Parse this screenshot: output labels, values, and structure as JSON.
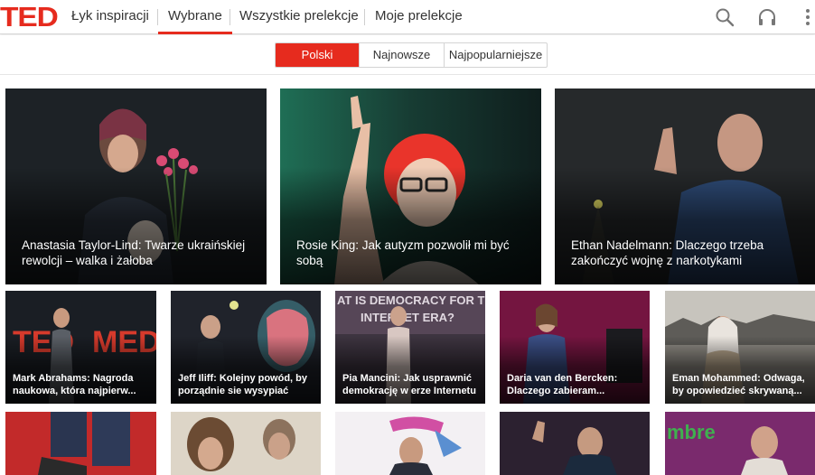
{
  "app": {
    "logo": "TED"
  },
  "nav": {
    "tabs": [
      {
        "label": "Łyk inspiracji"
      },
      {
        "label": "Wybrane"
      },
      {
        "label": "Wszystkie prelekcje"
      },
      {
        "label": "Moje prelekcje"
      }
    ],
    "active_tab": "Wybrane",
    "icons": [
      "search-icon",
      "headphones-icon",
      "overflow-menu-icon"
    ]
  },
  "filters": {
    "options": [
      {
        "label": "Polski"
      },
      {
        "label": "Najnowsze"
      },
      {
        "label": "Najpopularniejsze"
      }
    ],
    "selected": "Polski"
  },
  "featured": [
    {
      "title": "Anastasia Taylor-Lind: Twarze ukraińskiej rewolcji – walka i żałoba"
    },
    {
      "title": "Rosie King: Jak autyzm pozwolił mi być sobą"
    },
    {
      "title": "Ethan Nadelmann: Dlaczego trzeba zakończyć wojnę z narkotykami"
    }
  ],
  "talks_row1": [
    {
      "title": "Mark Abrahams: Nagroda naukowa, która najpierw..."
    },
    {
      "title": "Jeff Iliff: Kolejny powód, by porządnie sie wysypiać"
    },
    {
      "title": "Pia Mancini: Jak usprawnić demokrację w erze Internetu"
    },
    {
      "title": "Daria van den Bercken: Dlaczego zabieram..."
    },
    {
      "title": "Eman Mohammed: Odwaga, by opowiedzieć skrywaną..."
    }
  ],
  "talks_row2_count": 5,
  "colors": {
    "accent": "#e62b1e"
  }
}
